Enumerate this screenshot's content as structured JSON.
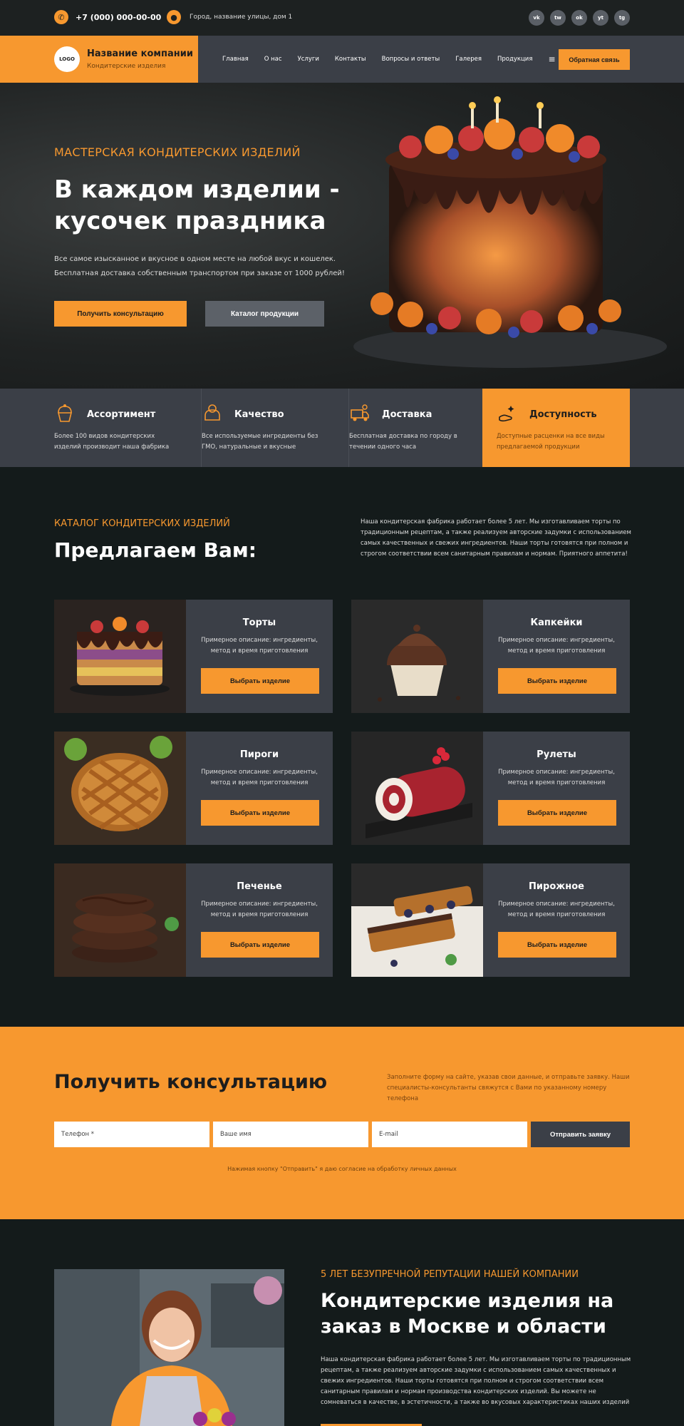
{
  "topbar": {
    "phone": "+7 (000) 000-00-00",
    "address": "Город, название улицы, дом 1",
    "socials": [
      "vk",
      "tw",
      "ok",
      "yt",
      "tg"
    ]
  },
  "header": {
    "logo": "LOGO",
    "company_name": "Название компании",
    "company_sub": "Кондитерские изделия",
    "nav": [
      "Главная",
      "О нас",
      "Услуги",
      "Контакты",
      "Вопросы и ответы",
      "Галерея",
      "Продукция"
    ],
    "feedback": "Обратная связь"
  },
  "hero": {
    "eyebrow": "МАСТЕРСКАЯ КОНДИТЕРСКИХ ИЗДЕЛИЙ",
    "title": "В каждом изделии - кусочек праздника",
    "text": "Все самое изысканное и вкусное в одном месте на любой вкус и кошелек. Бесплатная доставка собственным транспортом при заказе от 1000 рублей!",
    "btn_consult": "Получить консультацию",
    "btn_catalog": "Каталог продукции"
  },
  "features": [
    {
      "title": "Ассортимент",
      "text": "Более 100 видов кондитерских изделий производит наша фабрика"
    },
    {
      "title": "Качество",
      "text": "Все используемые ингредиенты без ГМО, натуральные и вкусные"
    },
    {
      "title": "Доставка",
      "text": "Бесплатная доставка по городу в течении одного часа"
    },
    {
      "title": "Доступность",
      "text": "Доступные расценки на все виды предлагаемой продукции"
    }
  ],
  "catalog": {
    "eyebrow": "КАТАЛОГ КОНДИТЕРСКИХ ИЗДЕЛИЙ",
    "title": "Предлагаем Вам:",
    "desc": "Наша кондитерская фабрика работает более 5 лет. Мы изготавливаем торты по традиционным рецептам, а также реализуем авторские задумки с использованием самых качественных и свежих ингредиентов. Наши торты готовятся при полном и строгом соответствии всем санитарным правилам и нормам. Приятного аппетита!",
    "card_desc": "Примерное описание: ингредиенты, метод и время приготовления",
    "card_btn": "Выбрать изделие",
    "items": [
      {
        "name": "Торты",
        "color": "#c98a4a"
      },
      {
        "name": "Капкейки",
        "color": "#5a3322"
      },
      {
        "name": "Пироги",
        "color": "#d08a3a"
      },
      {
        "name": "Рулеты",
        "color": "#a8232f"
      },
      {
        "name": "Печенье",
        "color": "#4a2a1c"
      },
      {
        "name": "Пирожное",
        "color": "#b5702c"
      }
    ]
  },
  "consult": {
    "title": "Получить консультацию",
    "desc": "Заполните форму на сайте, указав свои данные, и отправьте заявку. Наши специалисты-консультанты свяжутся с Вами по указанному номеру телефона",
    "phone_ph": "Телефон *",
    "name_ph": "Ваше имя",
    "email_ph": "E-mail",
    "submit": "Отправить заявку",
    "note": "Нажимая кнопку \"Отправить\" я даю согласие на обработку личных данных"
  },
  "about": {
    "eyebrow": "5 ЛЕТ БЕЗУПРЕЧНОЙ РЕПУТАЦИИ НАШЕЙ КОМПАНИИ",
    "title": "Кондитерские изделия на заказ в Москве и области",
    "text": "Наша кондитерская фабрика работает более 5 лет. Мы изготавливаем торты по традиционным рецептам, а также реализуем авторские задумки с использованием самых качественных и свежих ингредиентов. Наши торты готовятся при полном и строгом соответствии всем санитарным правилам и нормам производства кондитерских изделий. Вы можете не сомневаться в качестве, в эстетичности, а также во вкусовых характеристиках наших изделий"
  }
}
